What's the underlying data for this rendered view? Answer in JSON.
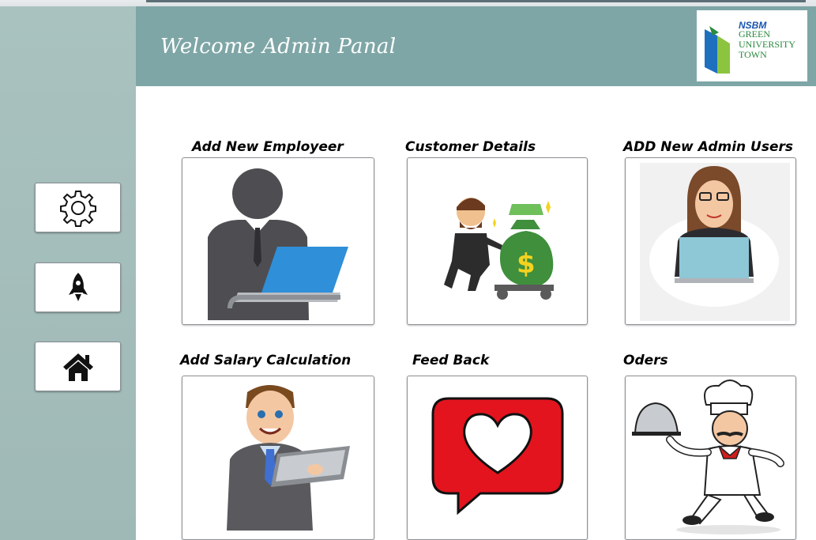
{
  "header": {
    "title": "Welcome Admin Panal"
  },
  "logo": {
    "brand": "NSBM",
    "line1": "GREEN",
    "line2": "UNIVERSITY",
    "line3": "TOWN"
  },
  "sidebar": {
    "buttons": [
      {
        "icon": "gear-icon"
      },
      {
        "icon": "rocket-icon"
      },
      {
        "icon": "home-icon"
      }
    ]
  },
  "cards": [
    {
      "label": "Add New Employeer",
      "icon": "employee-laptop-illustration"
    },
    {
      "label": "Customer Details",
      "icon": "money-bag-cart-illustration"
    },
    {
      "label": "ADD New Admin Users",
      "icon": "woman-laptop-illustration"
    },
    {
      "label": "Add Salary Calculation",
      "icon": "man-clipboard-illustration"
    },
    {
      "label": "Feed Back",
      "icon": "heart-chat-illustration"
    },
    {
      "label": "Oders",
      "icon": "chef-illustration"
    }
  ],
  "colors": {
    "header": "#7fa6a6",
    "sidebar": "#a9c2c0",
    "heart": "#e3141e"
  }
}
